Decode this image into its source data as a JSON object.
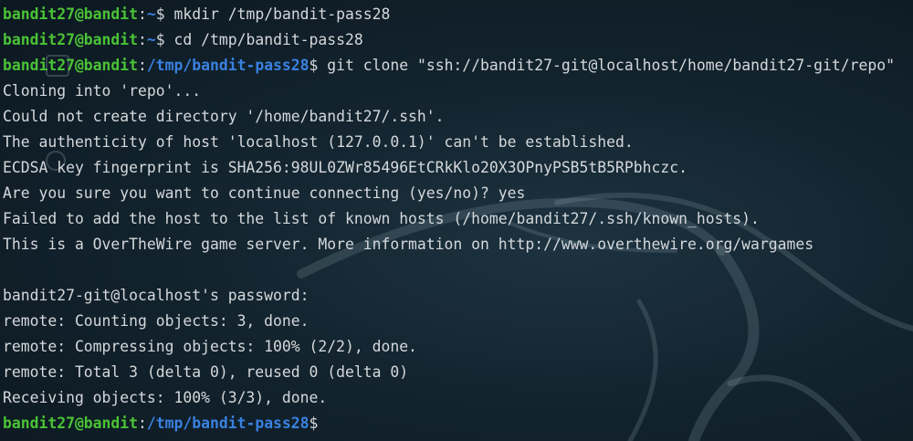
{
  "terminal": {
    "lines": [
      {
        "type": "prompt",
        "user": "bandit27@bandit",
        "sep": ":",
        "path": "~",
        "sym": "$ ",
        "cmd": "mkdir /tmp/bandit-pass28"
      },
      {
        "type": "prompt",
        "user": "bandit27@bandit",
        "sep": ":",
        "path": "~",
        "sym": "$ ",
        "cmd": "cd /tmp/bandit-pass28"
      },
      {
        "type": "prompt",
        "user": "bandit27@bandit",
        "sep": ":",
        "path": "/tmp/bandit-pass28",
        "sym": "$ ",
        "cmd": "git clone \"ssh://bandit27-git@localhost/home/bandit27-git/repo\""
      },
      {
        "type": "output",
        "text": "Cloning into 'repo'..."
      },
      {
        "type": "output",
        "text": "Could not create directory '/home/bandit27/.ssh'."
      },
      {
        "type": "output",
        "text": "The authenticity of host 'localhost (127.0.0.1)' can't be established."
      },
      {
        "type": "output",
        "text": "ECDSA key fingerprint is SHA256:98UL0ZWr85496EtCRkKlo20X3OPnyPSB5tB5RPbhczc."
      },
      {
        "type": "output",
        "text": "Are you sure you want to continue connecting (yes/no)? yes"
      },
      {
        "type": "output",
        "text": "Failed to add the host to the list of known hosts (/home/bandit27/.ssh/known_hosts)."
      },
      {
        "type": "output",
        "text": "This is a OverTheWire game server. More information on http://www.overthewire.org/wargames"
      },
      {
        "type": "output",
        "text": ""
      },
      {
        "type": "output",
        "text": "bandit27-git@localhost's password: "
      },
      {
        "type": "output",
        "text": "remote: Counting objects: 3, done."
      },
      {
        "type": "output",
        "text": "remote: Compressing objects: 100% (2/2), done."
      },
      {
        "type": "output",
        "text": "remote: Total 3 (delta 0), reused 0 (delta 0)"
      },
      {
        "type": "output",
        "text": "Receiving objects: 100% (3/3), done."
      },
      {
        "type": "prompt",
        "user": "bandit27@bandit",
        "sep": ":",
        "path": "/tmp/bandit-pass28",
        "sym": "$",
        "cmd": ""
      }
    ]
  },
  "colors": {
    "user": "#4bc336",
    "path": "#3a81e0",
    "text": "#d4d8db",
    "background": "#13242f"
  },
  "desktop_icons": [
    {
      "name": "file-manager-icon"
    },
    {
      "name": "settings-icon"
    }
  ]
}
